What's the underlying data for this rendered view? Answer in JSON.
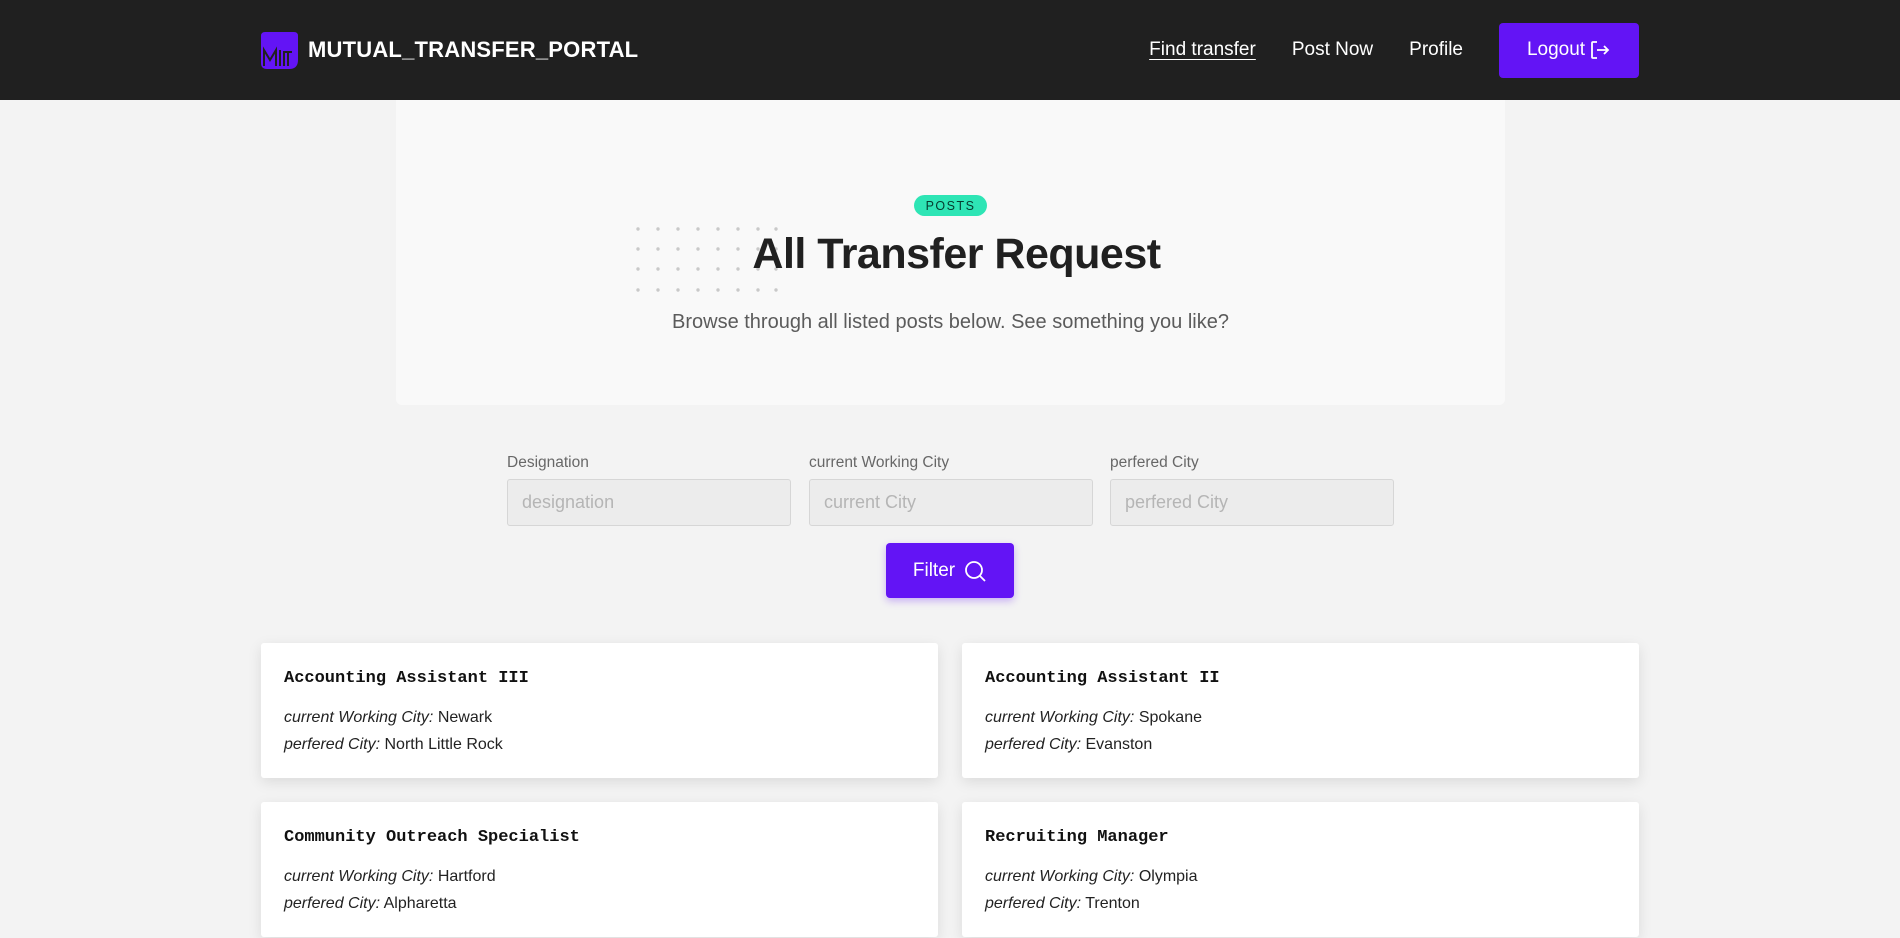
{
  "header": {
    "brand": "MUTUAL_TRANSFER_PORTAL",
    "nav": [
      {
        "label": "Find transfer",
        "active": true
      },
      {
        "label": "Post Now",
        "active": false
      },
      {
        "label": "Profile",
        "active": false
      }
    ],
    "logout_label": "Logout",
    "accent": "#6314f5"
  },
  "hero": {
    "badge": "POSTS",
    "title": "All Transfer Request",
    "subtitle": "Browse through all listed posts below. See something you like?"
  },
  "filters": {
    "designation": {
      "label": "Designation",
      "placeholder": "designation",
      "value": ""
    },
    "current_city": {
      "label": "current Working City",
      "placeholder": "current City",
      "value": ""
    },
    "preferred_city": {
      "label": "perfered City",
      "placeholder": "perfered City",
      "value": ""
    },
    "button_label": "Filter"
  },
  "posts": {
    "current_label": "current Working City:",
    "preferred_label": "perfered City:",
    "items": [
      {
        "designation": "Accounting Assistant III",
        "current_city": "Newark",
        "preferred_city": "North Little Rock"
      },
      {
        "designation": "Accounting Assistant II",
        "current_city": "Spokane",
        "preferred_city": "Evanston"
      },
      {
        "designation": "Community Outreach Specialist",
        "current_city": "Hartford",
        "preferred_city": "Alpharetta"
      },
      {
        "designation": "Recruiting Manager",
        "current_city": "Olympia",
        "preferred_city": "Trenton"
      }
    ]
  }
}
